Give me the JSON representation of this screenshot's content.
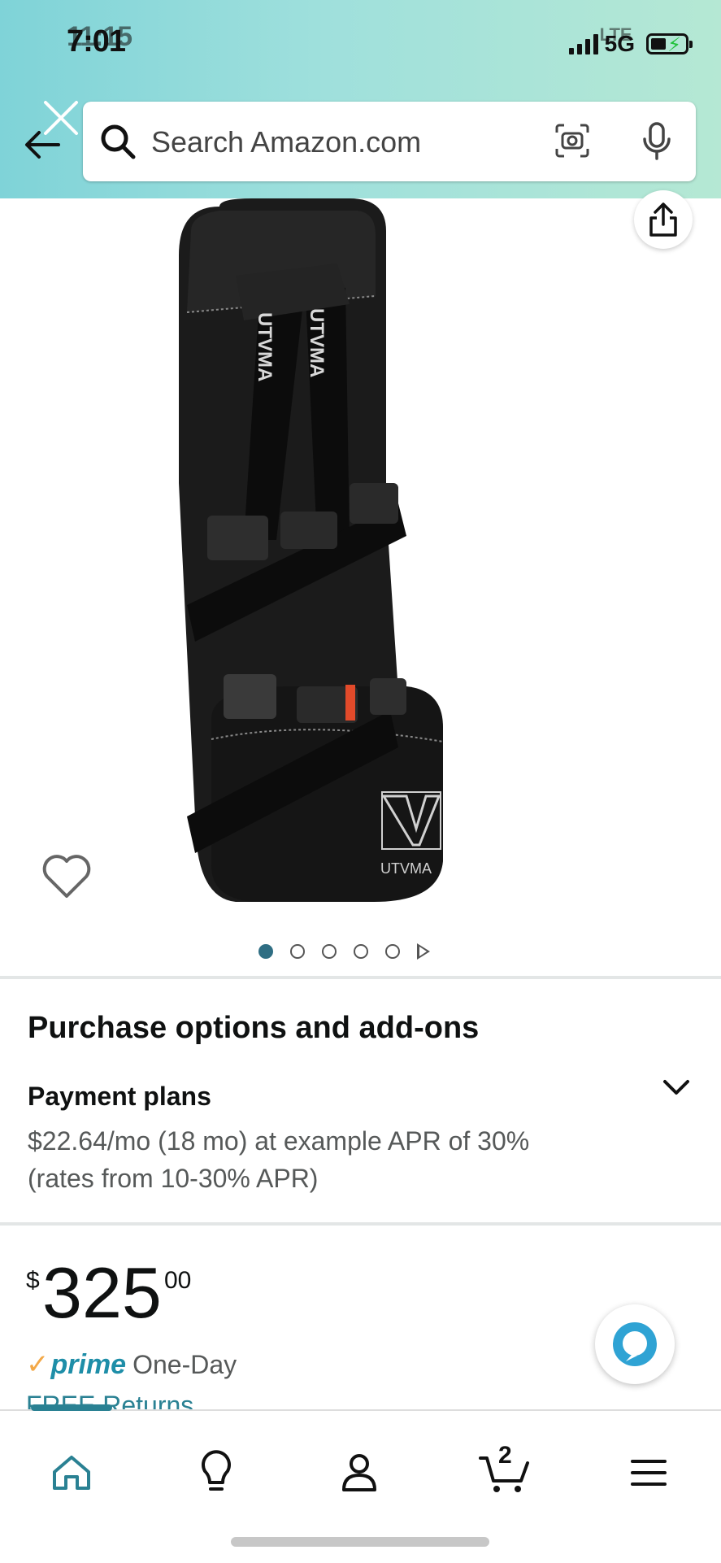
{
  "status_bar": {
    "time": "7:01",
    "time_overlay": "11:15",
    "network": "5G",
    "network_overlay": "LTE"
  },
  "search": {
    "placeholder": "Search Amazon.com"
  },
  "product": {
    "image_alt": "UTVMA seat with harness",
    "logo_text": "UTVMA",
    "carousel_count": 5,
    "carousel_active_index": 0
  },
  "purchase": {
    "section_title": "Purchase options and add-ons",
    "payment_title": "Payment plans",
    "payment_desc": "$22.64/mo (18 mo) at example APR of 30% (rates from 10-30% APR)"
  },
  "price": {
    "symbol": "$",
    "whole": "325",
    "fraction": "00"
  },
  "prime": {
    "check": "✓",
    "label": "prime",
    "speed": "One-Day"
  },
  "returns": {
    "label": "FREE Returns"
  },
  "nav": {
    "cart_count": "2"
  },
  "colors": {
    "accent": "#2a8193",
    "prime_blue": "#1e8ea8",
    "prime_check": "#f3a847",
    "header_start": "#7fd3d8",
    "header_end": "#b5e8d4"
  }
}
